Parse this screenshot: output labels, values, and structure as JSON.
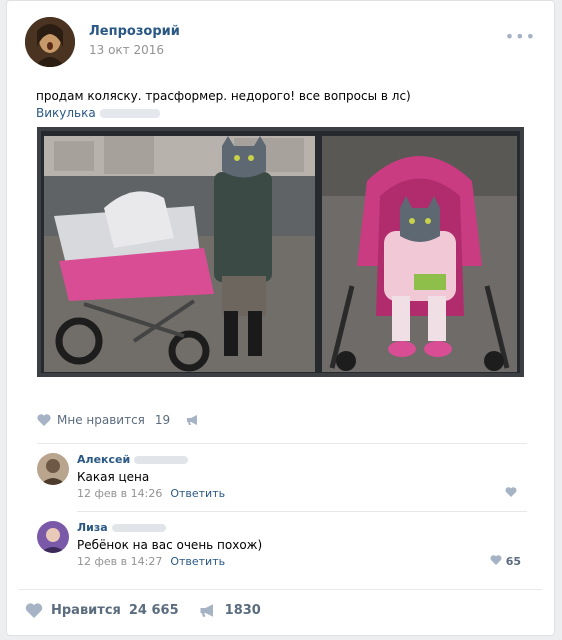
{
  "post": {
    "author": "Лепрозорий",
    "date": "13 окт 2016",
    "text": "продам коляску. трасформер. недорого! все вопросы в лс)",
    "signature": "Викулька",
    "more_icon": "more-dots-icon"
  },
  "likes_row": {
    "label": "Мне нравится",
    "count": "19"
  },
  "comments": [
    {
      "name": "Алексей",
      "text": "Какая цена",
      "time": "12 фев в 14:26",
      "reply": "Ответить",
      "likes": ""
    },
    {
      "name": "Лиза",
      "text": "Ребёнок на вас очень похож)",
      "time": "12 фев в 14:27",
      "reply": "Ответить",
      "likes": "65"
    }
  ],
  "footer": {
    "like_label": "Нравится",
    "like_count": "24 665",
    "share_count": "1830"
  },
  "colors": {
    "link": "#2a5885",
    "muted": "#939393",
    "icon": "#a5b3c4"
  }
}
